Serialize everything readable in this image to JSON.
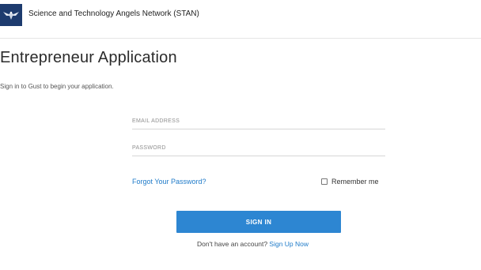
{
  "header": {
    "logo_icon": "stan-eagle-logo-icon",
    "org_name": "Science and Technology Angels Network (STAN)",
    "logo_color": "#1d3b6e"
  },
  "main": {
    "title": "Entrepreneur Application",
    "subtitle": "Sign in to Gust to begin your application."
  },
  "form": {
    "email": {
      "placeholder": "EMAIL ADDRESS",
      "value": ""
    },
    "password": {
      "placeholder": "PASSWORD",
      "value": ""
    },
    "forgot_password": "Forgot Your Password?",
    "remember_me": {
      "label": "Remember me",
      "checked": false
    },
    "signin_button": "SIGN IN",
    "signup_prompt": "Don't have an account?",
    "signup_link": "Sign Up Now"
  },
  "colors": {
    "accent": "#2d86d2",
    "link": "#1f7bc9"
  }
}
